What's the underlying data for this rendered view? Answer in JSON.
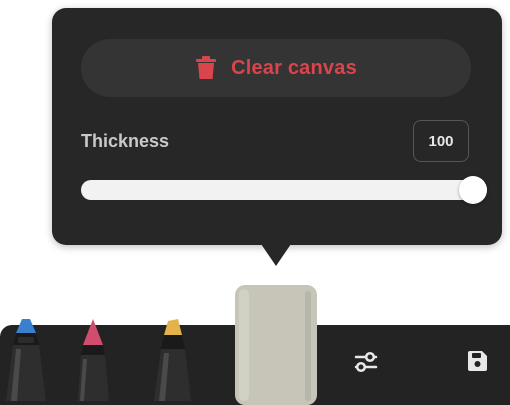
{
  "popover": {
    "clear_label": "Clear canvas",
    "clear_icon": "trash-icon",
    "thickness_label": "Thickness",
    "thickness_value": "100",
    "thickness_fraction": 1.0
  },
  "toolbar": {
    "tools": [
      {
        "name": "pen-tool-blue",
        "tip_color": "#3d7fcf"
      },
      {
        "name": "pen-tool-pink",
        "tip_color": "#d04d6e"
      },
      {
        "name": "pen-tool-yellow",
        "tip_color": "#e3b24a"
      },
      {
        "name": "eraser-tool",
        "color": "#c6c5b8"
      }
    ],
    "settings_icon": "sliders-icon",
    "save_icon": "save-icon"
  },
  "colors": {
    "popover_bg": "#272727",
    "accent_red": "#d8454d",
    "toolbar_bg": "#232323"
  }
}
